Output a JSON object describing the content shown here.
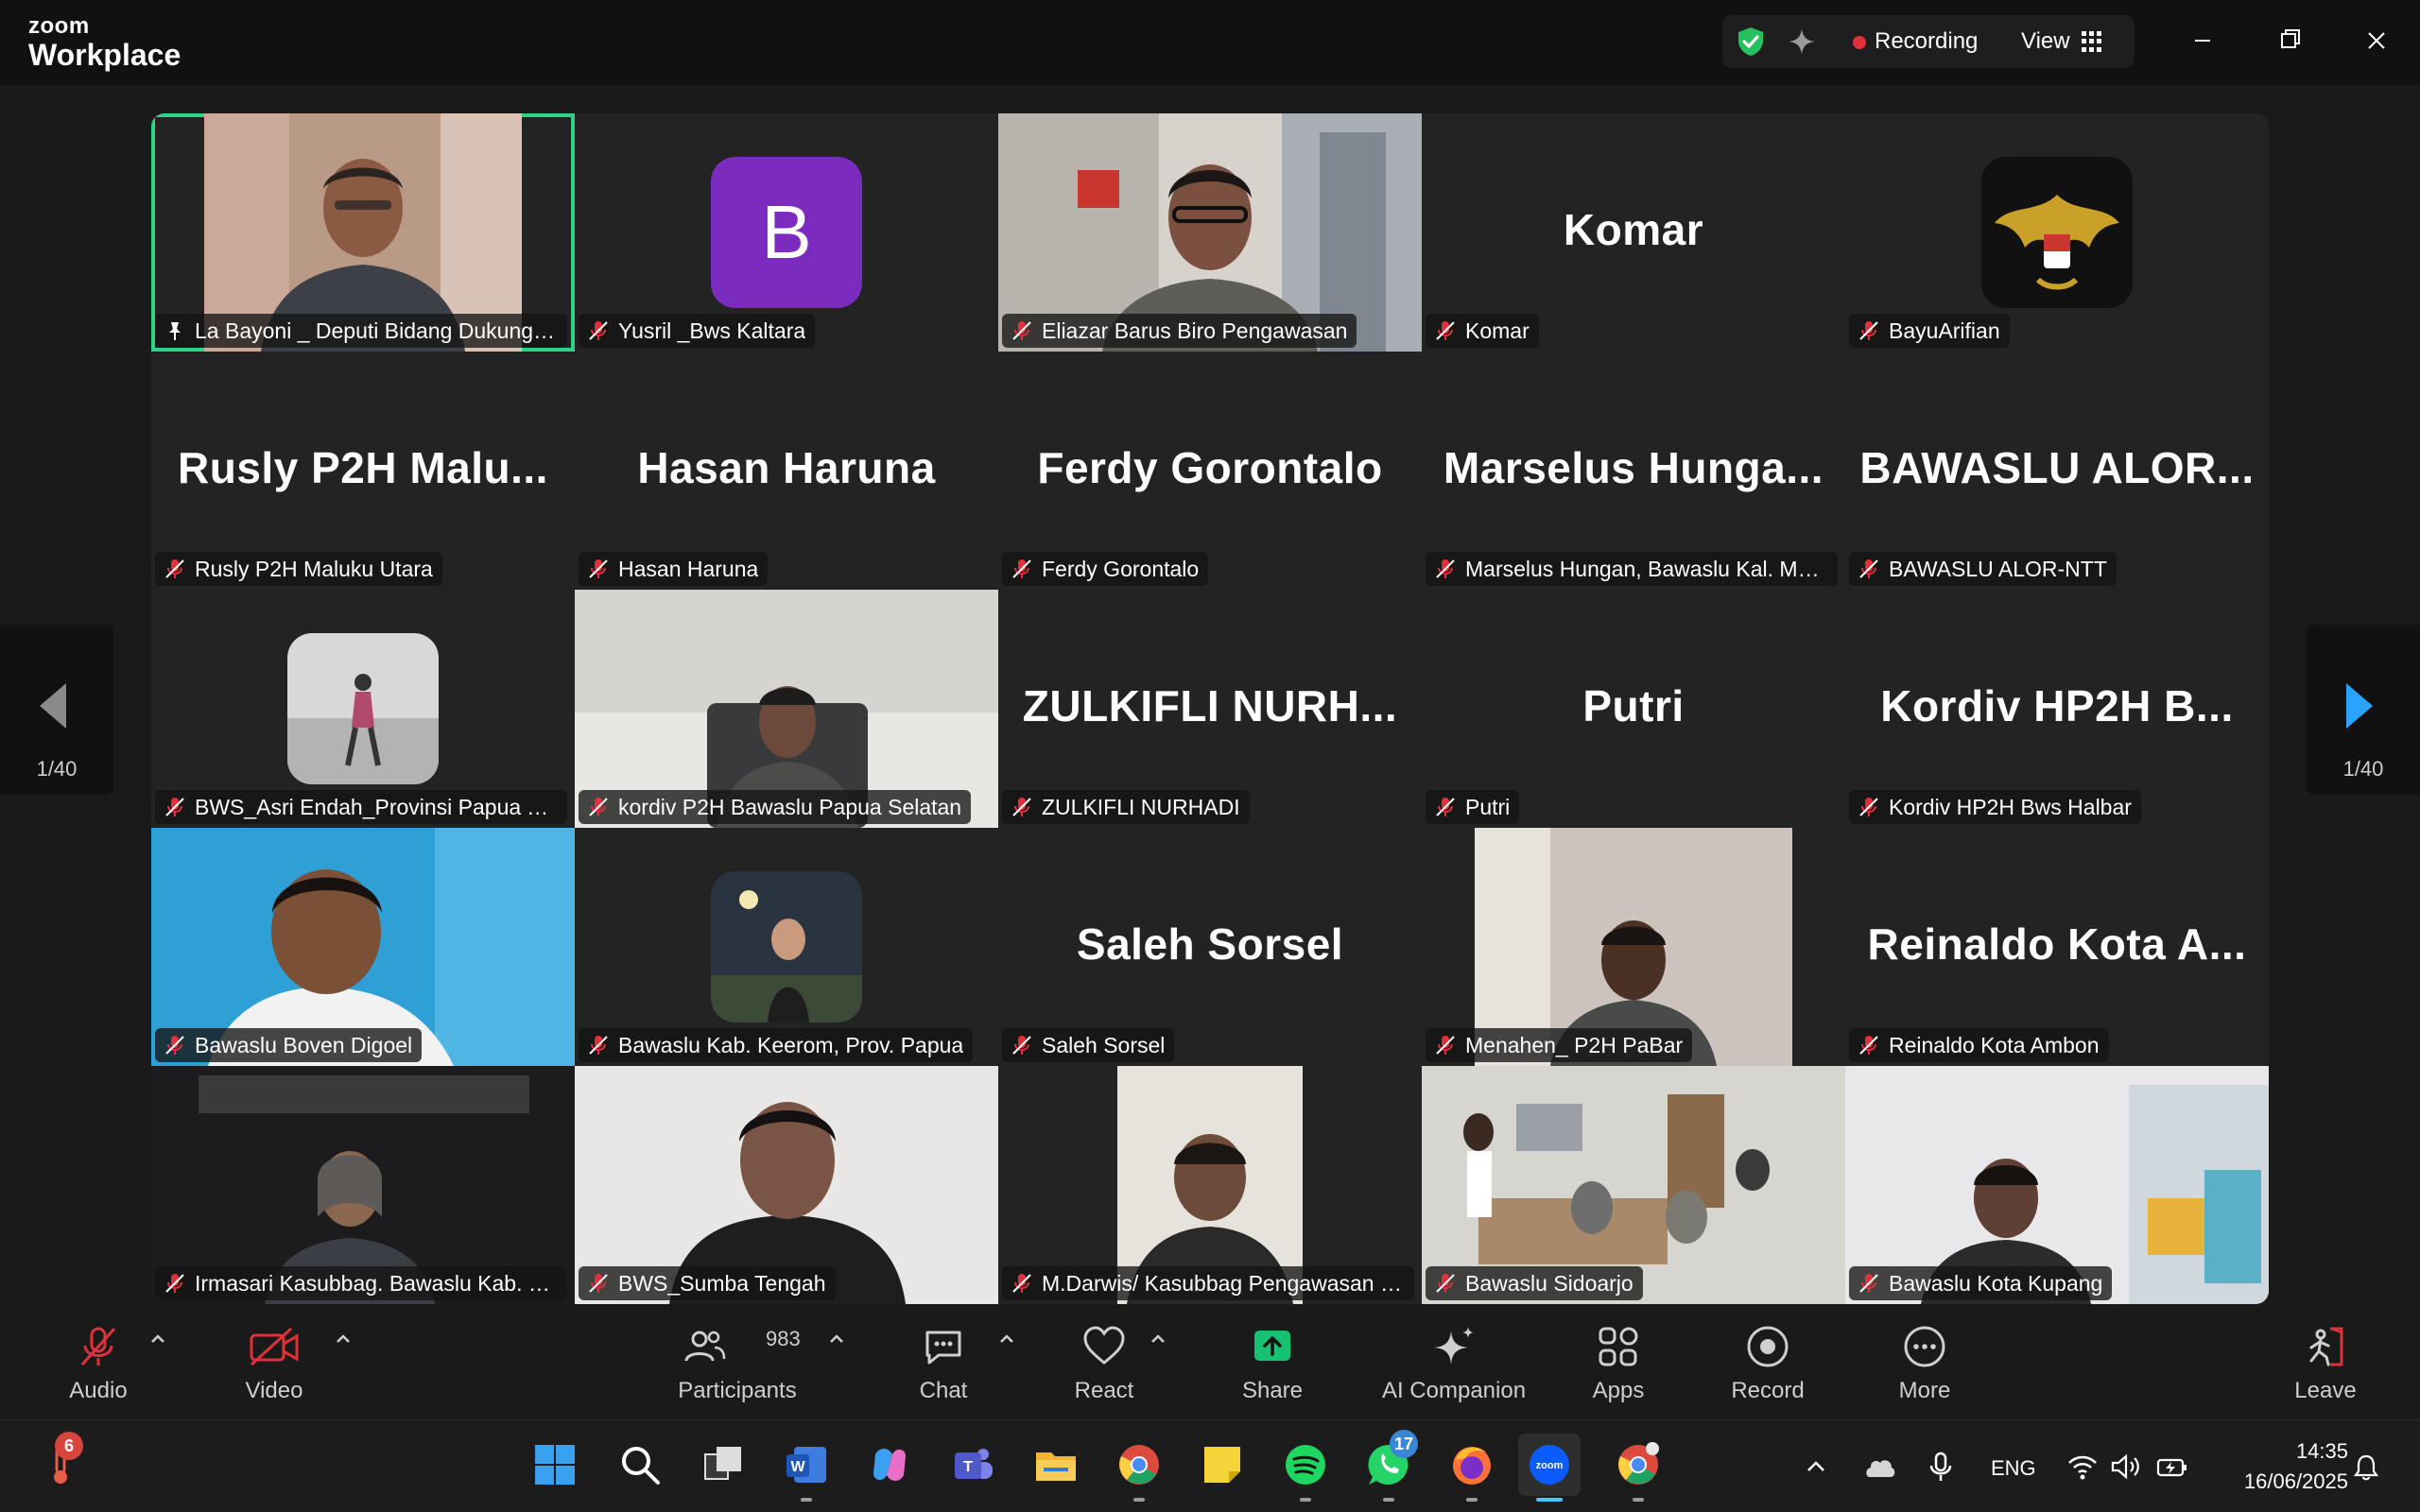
{
  "app": {
    "brand_top": "zoom",
    "brand_bottom": "Workplace"
  },
  "titlebar": {
    "recording_label": "Recording",
    "view_label": "View"
  },
  "pagination": {
    "left_page": "1/40",
    "right_page": "1/40"
  },
  "tiles": [
    {
      "name": "La Bayoni _ Deputi Bidang Dukunga...",
      "type": "video",
      "active": true,
      "pinned": true
    },
    {
      "name": "Yusril _Bws Kaltara",
      "type": "avatar",
      "avatar_letter": "B"
    },
    {
      "name": "Eliazar Barus Biro Pengawasan",
      "type": "video"
    },
    {
      "name": "Komar",
      "type": "name",
      "display": "Komar"
    },
    {
      "name": "BayuArifian",
      "type": "avatar_img"
    },
    {
      "name": "Rusly P2H Maluku Utara",
      "type": "name",
      "display": "Rusly  P2H  Malu..."
    },
    {
      "name": "Hasan Haruna",
      "type": "name",
      "display": "Hasan Haruna"
    },
    {
      "name": "Ferdy Gorontalo",
      "type": "name",
      "display": "Ferdy Gorontalo"
    },
    {
      "name": "Marselus Hungan, Bawaslu Kal. Mal...",
      "type": "name",
      "display": "Marselus  Hunga..."
    },
    {
      "name": "BAWASLU ALOR-NTT",
      "type": "name",
      "display": "BAWASLU  ALOR..."
    },
    {
      "name": "BWS_Asri Endah_Provinsi Papua Ten...",
      "type": "avatar_img"
    },
    {
      "name": "kordiv P2H Bawaslu Papua Selatan",
      "type": "video"
    },
    {
      "name": "ZULKIFLI NURHADI",
      "type": "name",
      "display": "ZULKIFLI  NURH..."
    },
    {
      "name": "Putri",
      "type": "name",
      "display": "Putri"
    },
    {
      "name": "Kordiv HP2H Bws Halbar",
      "type": "name",
      "display": "Kordiv  HP2H  B..."
    },
    {
      "name": "Bawaslu Boven Digoel",
      "type": "video"
    },
    {
      "name": "Bawaslu Kab. Keerom, Prov. Papua",
      "type": "avatar_img"
    },
    {
      "name": "Saleh Sorsel",
      "type": "name",
      "display": "Saleh Sorsel"
    },
    {
      "name": "Menahen_ P2H PaBar",
      "type": "video"
    },
    {
      "name": "Reinaldo Kota Ambon",
      "type": "name",
      "display": "Reinaldo  Kota  A..."
    },
    {
      "name": "Irmasari Kasubbag. Bawaslu Kab. Je...",
      "type": "video"
    },
    {
      "name": "BWS_Sumba Tengah",
      "type": "video"
    },
    {
      "name": "M.Darwis/ Kasubbag Pengawasan K...",
      "type": "video"
    },
    {
      "name": "Bawaslu Sidoarjo",
      "type": "video"
    },
    {
      "name": "Bawaslu Kota Kupang",
      "type": "video"
    }
  ],
  "toolbar": {
    "audio": "Audio",
    "video": "Video",
    "participants": "Participants",
    "participants_count": "983",
    "chat": "Chat",
    "react": "React",
    "share": "Share",
    "ai_companion": "AI Companion",
    "apps": "Apps",
    "record": "Record",
    "more": "More",
    "leave": "Leave"
  },
  "taskbar": {
    "weather_badge": "6",
    "whatsapp_badge": "17",
    "language": "ENG",
    "time": "14:35",
    "date": "16/06/2025"
  },
  "colors": {
    "active_speaker": "#2fd489",
    "share_green": "#16c172",
    "leave_red": "#e0313b",
    "arrow_blue": "#2aa3ff"
  }
}
